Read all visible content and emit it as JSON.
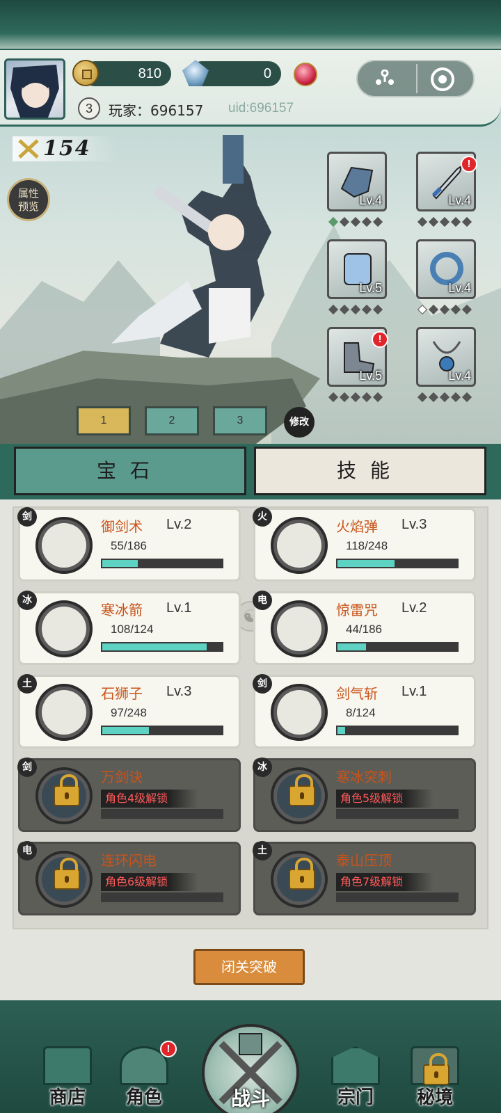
{
  "header": {
    "coins": "810",
    "gems": "0",
    "player_level": "3",
    "player_name": "玩家：696157",
    "uid": "uid:696157"
  },
  "character": {
    "power": "154",
    "attribute_preview": "属性\n预览"
  },
  "equipment": [
    {
      "name": "helmet",
      "level": "Lv.4",
      "icon": "shoulder-armor-icon",
      "alert": false
    },
    {
      "name": "weapon",
      "level": "Lv.4",
      "icon": "sword-icon",
      "alert": true
    },
    {
      "name": "armor",
      "level": "Lv.5",
      "icon": "armor-icon",
      "alert": false
    },
    {
      "name": "ring",
      "level": "Lv.4",
      "icon": "ring-icon",
      "alert": false
    },
    {
      "name": "boots",
      "level": "Lv.5",
      "icon": "boots-icon",
      "alert": true
    },
    {
      "name": "necklace",
      "level": "Lv.4",
      "icon": "necklace-icon",
      "alert": false
    }
  ],
  "loadout": {
    "slots": [
      "1",
      "2",
      "3"
    ],
    "active": "1",
    "modify_label": "修改"
  },
  "tabs": {
    "gem": "宝石",
    "skill": "技能"
  },
  "skills": [
    {
      "element": "剑",
      "name": "御剑术",
      "level": "Lv.2",
      "progress": "55/186",
      "fraction": 0.296,
      "locked": false
    },
    {
      "element": "火",
      "name": "火焰弹",
      "level": "Lv.3",
      "progress": "118/248",
      "fraction": 0.476,
      "locked": false
    },
    {
      "element": "冰",
      "name": "寒冰箭",
      "level": "Lv.1",
      "progress": "108/124",
      "fraction": 0.871,
      "locked": false
    },
    {
      "element": "电",
      "name": "惊雷咒",
      "level": "Lv.2",
      "progress": "44/186",
      "fraction": 0.237,
      "locked": false
    },
    {
      "element": "土",
      "name": "石狮子",
      "level": "Lv.3",
      "progress": "97/248",
      "fraction": 0.391,
      "locked": false
    },
    {
      "element": "剑",
      "name": "剑气斩",
      "level": "Lv.1",
      "progress": "8/124",
      "fraction": 0.065,
      "locked": false
    },
    {
      "element": "剑",
      "name": "万剑诀",
      "unlock": "角色4级解锁",
      "locked": true
    },
    {
      "element": "冰",
      "name": "寒冰突刺",
      "unlock": "角色5级解锁",
      "locked": true
    },
    {
      "element": "电",
      "name": "连环闪电",
      "unlock": "角色6级解锁",
      "locked": true
    },
    {
      "element": "土",
      "name": "泰山压顶",
      "unlock": "角色7级解锁",
      "locked": true
    }
  ],
  "breakthrough_label": "闭关突破",
  "nav": {
    "shop": "商店",
    "role": "角色",
    "battle": "战斗",
    "sect": "宗门",
    "secret": "秘境"
  },
  "colors": {
    "accent_teal": "#2e6a5c",
    "progress_fill": "#5fd3c3",
    "skill_name": "#c9541a",
    "alert_red": "#e0262b"
  }
}
